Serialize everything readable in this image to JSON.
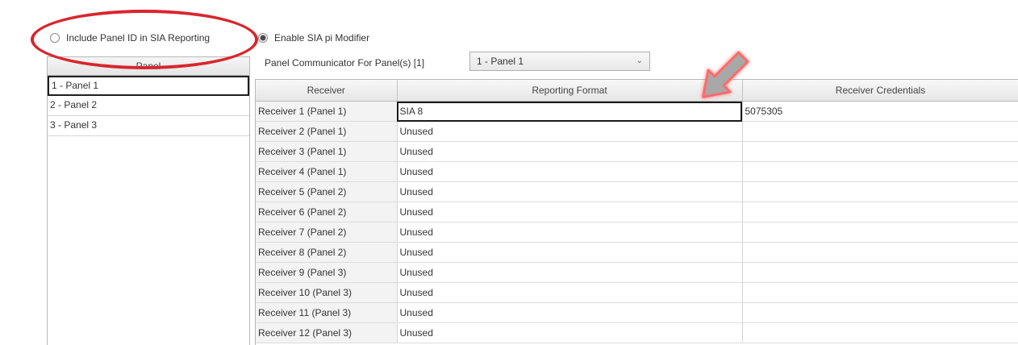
{
  "options": {
    "include_panel_id_label": "Include Panel ID in SIA Reporting",
    "enable_sia_modifier_label": "Enable SIA pi Modifier"
  },
  "panels": {
    "header": "Panel",
    "items": [
      "1 - Panel 1",
      "2 - Panel 2",
      "3 - Panel 3"
    ],
    "selected_index": 0
  },
  "communicator": {
    "label": "Panel Communicator For Panel(s) [1]",
    "selected": "1 - Panel 1"
  },
  "grid": {
    "headers": [
      "Receiver",
      "Reporting Format",
      "Receiver Credentials"
    ],
    "rows": [
      {
        "receiver": "Receiver 1 (Panel 1)",
        "format": "SIA 8",
        "credentials": "5075305"
      },
      {
        "receiver": "Receiver 2 (Panel 1)",
        "format": "Unused",
        "credentials": ""
      },
      {
        "receiver": "Receiver 3 (Panel 1)",
        "format": "Unused",
        "credentials": ""
      },
      {
        "receiver": "Receiver 4 (Panel 1)",
        "format": "Unused",
        "credentials": ""
      },
      {
        "receiver": "Receiver 5 (Panel 2)",
        "format": "Unused",
        "credentials": ""
      },
      {
        "receiver": "Receiver 6 (Panel 2)",
        "format": "Unused",
        "credentials": ""
      },
      {
        "receiver": "Receiver 7 (Panel 2)",
        "format": "Unused",
        "credentials": ""
      },
      {
        "receiver": "Receiver 8 (Panel 2)",
        "format": "Unused",
        "credentials": ""
      },
      {
        "receiver": "Receiver 9 (Panel 3)",
        "format": "Unused",
        "credentials": ""
      },
      {
        "receiver": "Receiver 10 (Panel 3)",
        "format": "Unused",
        "credentials": ""
      },
      {
        "receiver": "Receiver 11 (Panel 3)",
        "format": "Unused",
        "credentials": ""
      },
      {
        "receiver": "Receiver 12 (Panel 3)",
        "format": "Unused",
        "credentials": ""
      }
    ]
  },
  "icons": {
    "dropdown": "chevron-down-icon",
    "annotation_arrow": "arrow-pointer-icon",
    "annotation_circle": "highlight-ellipse"
  },
  "colors": {
    "annotation_red": "#d8262c",
    "arrow_fill": "#a8a8a8",
    "arrow_glow": "#ff6b6b"
  }
}
